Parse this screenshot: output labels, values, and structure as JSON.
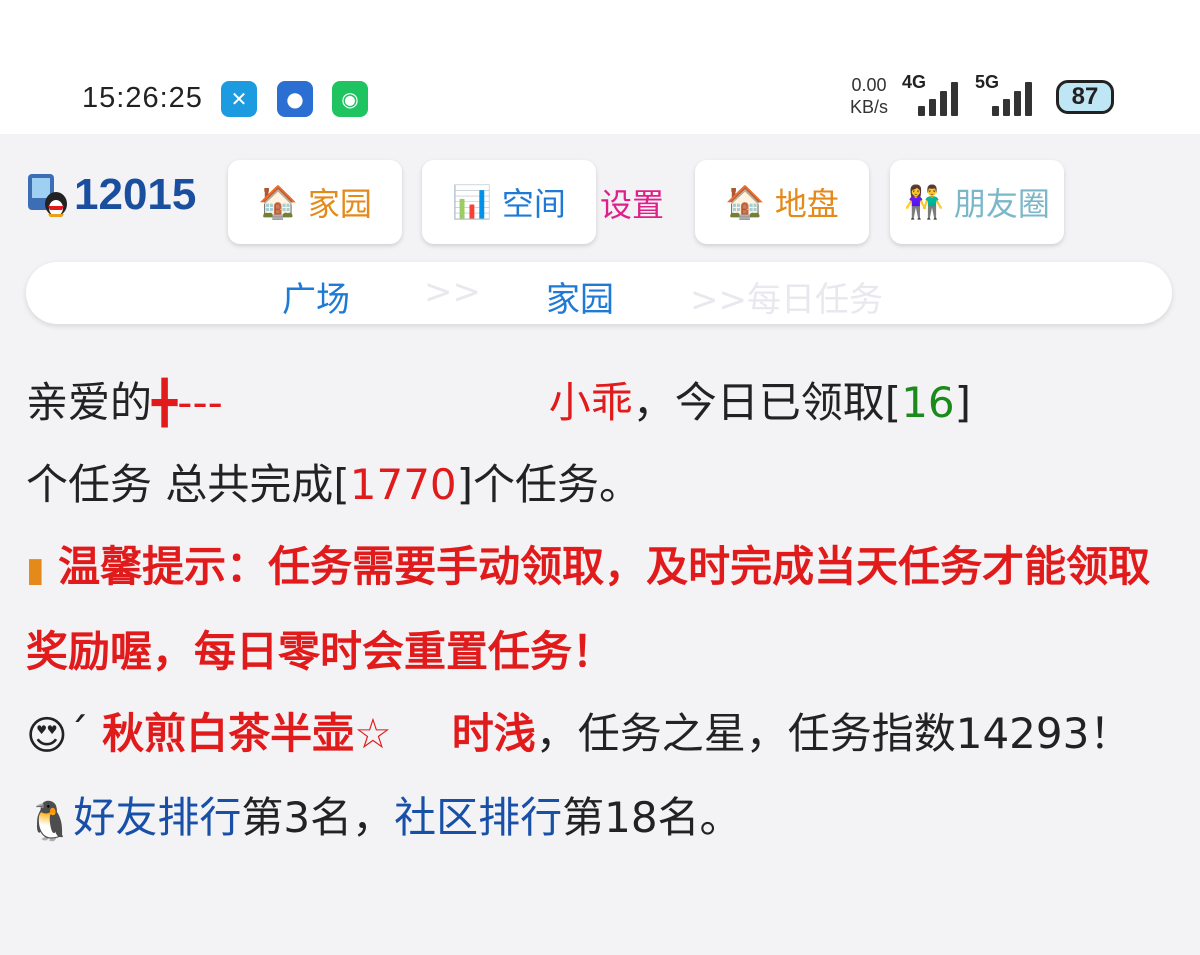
{
  "status_bar": {
    "time": "15:26:25",
    "net_speed_value": "0.00",
    "net_speed_unit": "KB/s",
    "signal_4g": "4G",
    "signal_5g": "5G",
    "battery": "87"
  },
  "header": {
    "site_id": "12015",
    "nav": [
      {
        "label": "家园",
        "icon": "house-icon",
        "color": "#e48a1a"
      },
      {
        "label": "空间",
        "icon": "bar-chart-icon",
        "color": "#1f7ad6"
      },
      {
        "label": "地盘",
        "icon": "house-icon",
        "color": "#e48a1a"
      },
      {
        "label": "朋友圈",
        "icon": "people-icon",
        "color": "#7ab7c9"
      }
    ],
    "settings_label": "设置"
  },
  "breadcrumb": {
    "items": [
      "广场",
      "家园"
    ],
    "separator": ">>",
    "current": ">>每日任务"
  },
  "message": {
    "greeting": "亲爱的",
    "user_prefix": "╋---",
    "user_name": "小乖",
    "claimed_text_a": "，今日已领取[",
    "claimed_count": "16",
    "claimed_text_b": "]",
    "total_text_a": "个任务 总共完成[",
    "total_count": "1770",
    "total_text_b": "]个任务。",
    "tip": "温馨提示：任务需要手动领取，及时完成当天任务才能领取奖励喔，每日零时会重置任务！",
    "star_mark": "ˊ",
    "star_user": "秋煎白茶半壶☆",
    "star_user_b": "时浅",
    "star_text": "，任务之星，任务指数14293！",
    "rank_friends_link": "好友排行",
    "rank_friends_text": "第3名，",
    "rank_community_link": "社区排行",
    "rank_community_text": "第18名。"
  }
}
